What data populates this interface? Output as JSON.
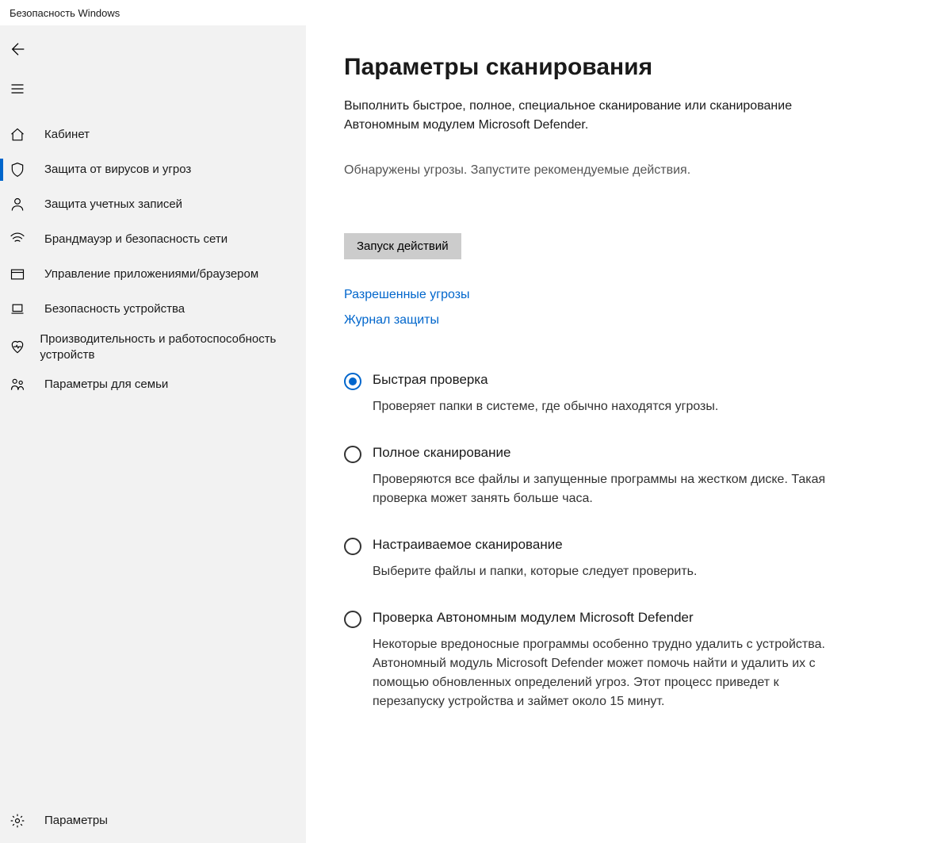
{
  "window": {
    "title": "Безопасность Windows"
  },
  "sidebar": {
    "items": [
      {
        "label": "Кабинет"
      },
      {
        "label": "Защита от вирусов и угроз"
      },
      {
        "label": "Защита учетных записей"
      },
      {
        "label": "Брандмауэр и безопасность сети"
      },
      {
        "label": "Управление приложениями/браузером"
      },
      {
        "label": "Безопасность устройства"
      },
      {
        "label": "Производительность и работоспособность устройств"
      },
      {
        "label": "Параметры для семьи"
      }
    ],
    "settings_label": "Параметры"
  },
  "main": {
    "title": "Параметры сканирования",
    "subtitle": "Выполнить быстрое, полное, специальное сканирование или сканирование Автономным модулем Microsoft Defender.",
    "status": "Обнаружены угрозы. Запустите рекомендуемые действия.",
    "action_button": "Запуск действий",
    "links": {
      "allowed": "Разрешенные угрозы",
      "history": "Журнал защиты"
    },
    "scan_options": [
      {
        "title": "Быстрая проверка",
        "desc": "Проверяет папки в системе, где обычно находятся угрозы.",
        "checked": true
      },
      {
        "title": "Полное сканирование",
        "desc": "Проверяются все файлы и запущенные программы на жестком диске. Такая проверка может занять больше часа.",
        "checked": false
      },
      {
        "title": "Настраиваемое сканирование",
        "desc": "Выберите файлы и папки, которые следует проверить.",
        "checked": false
      },
      {
        "title": "Проверка Автономным модулем Microsoft Defender",
        "desc": "Некоторые вредоносные программы особенно трудно удалить с устройства. Автономный модуль Microsoft Defender может помочь найти и удалить их с помощью обновленных определений угроз. Этот процесс приведет к перезапуску устройства и займет около 15 минут.",
        "checked": false
      }
    ]
  }
}
